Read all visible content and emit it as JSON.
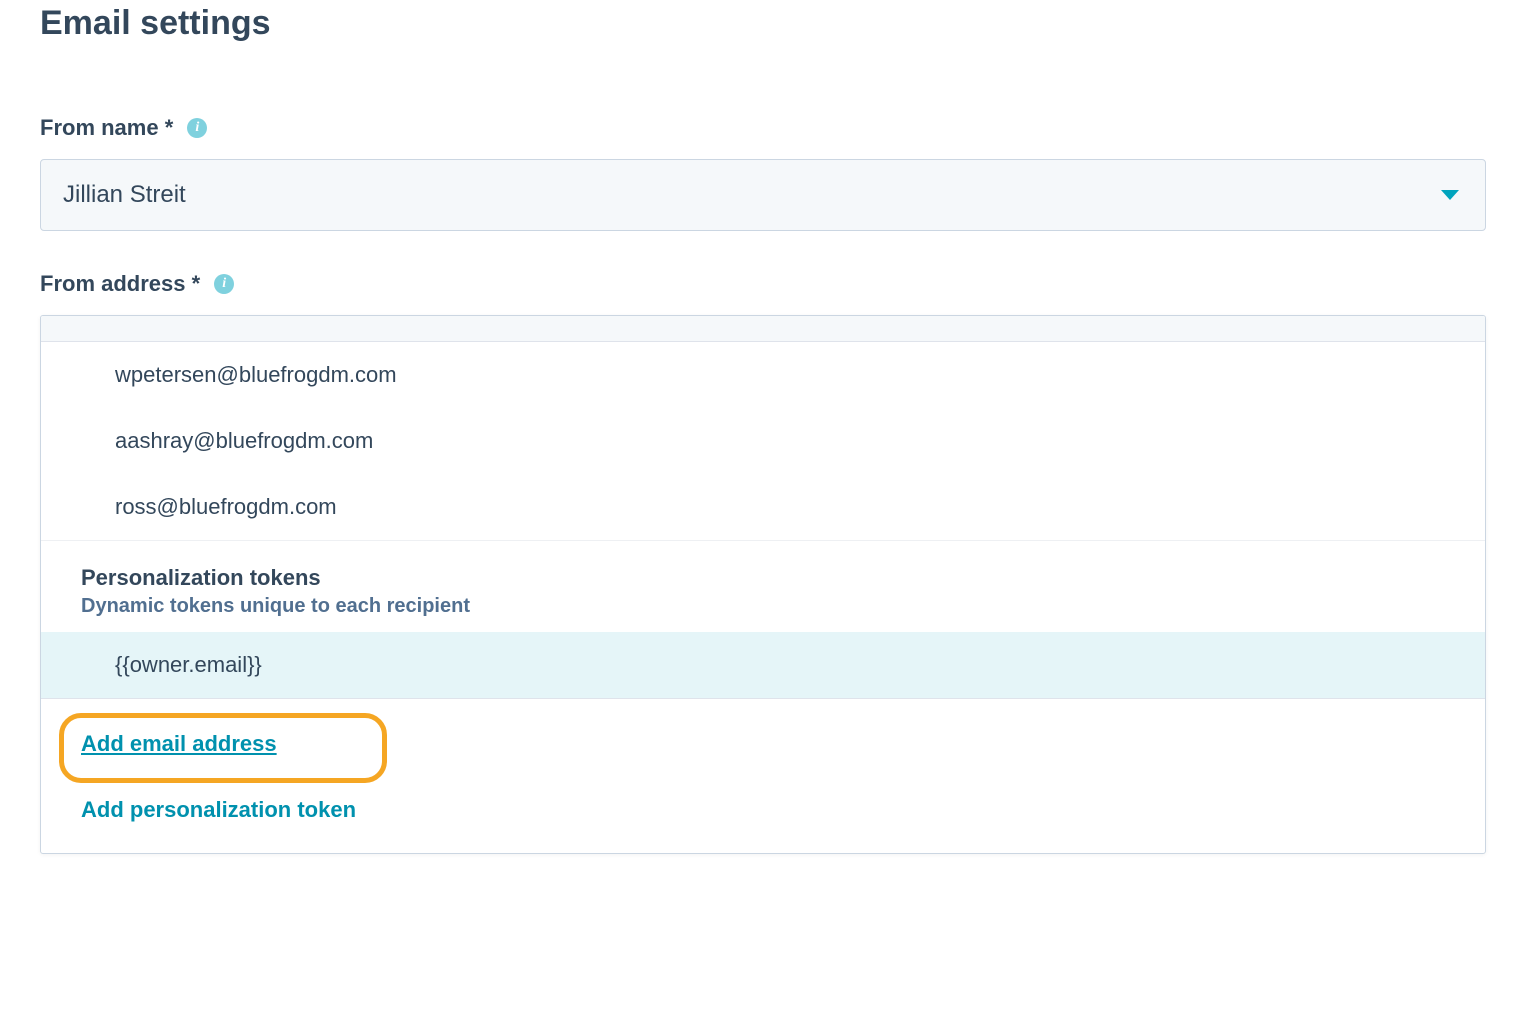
{
  "section_title": "Email settings",
  "from_name": {
    "label": "From name *",
    "value": "Jillian Streit"
  },
  "from_address": {
    "label": "From address *",
    "options": [
      "wpetersen@bluefrogdm.com",
      "aashray@bluefrogdm.com",
      "ross@bluefrogdm.com"
    ],
    "tokens_header": "Personalization tokens",
    "tokens_subtitle": "Dynamic tokens unique to each recipient",
    "token_option": "{{owner.email}}",
    "add_email_label": "Add email address",
    "add_token_label": "Add personalization token"
  },
  "info_glyph": "i"
}
